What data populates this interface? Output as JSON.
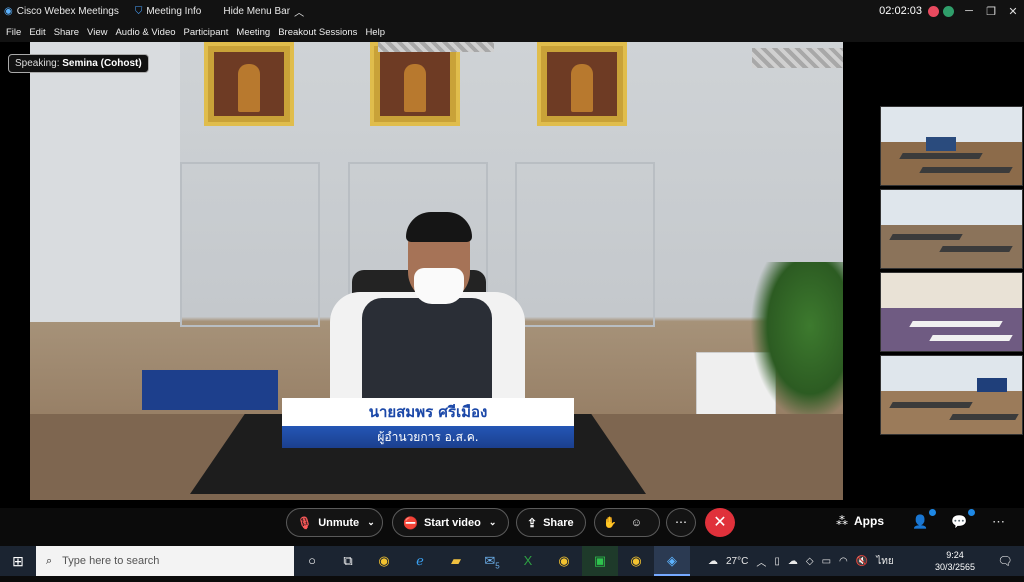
{
  "titlebar": {
    "app_name": "Cisco Webex Meetings",
    "meeting_info": "Meeting Info",
    "hide_menu_bar": "Hide Menu Bar",
    "time": "02:02:03"
  },
  "menu": {
    "items": [
      "File",
      "Edit",
      "Share",
      "View",
      "Audio & Video",
      "Participant",
      "Meeting",
      "Breakout Sessions",
      "Help"
    ]
  },
  "speaking": {
    "prefix": "Speaking:",
    "name": "Semina (Cohost)"
  },
  "caption": {
    "name": "นายสมพร  ศรีเมือง",
    "title": "ผู้อำนวยการ อ.ส.ค."
  },
  "controls": {
    "unmute": "Unmute",
    "start_video": "Start video",
    "share": "Share",
    "apps": "Apps"
  },
  "taskbar": {
    "search_placeholder": "Type here to search",
    "mail_badge": "5",
    "weather": "27°C",
    "language": "ไทย",
    "time": "9:24",
    "date": "30/3/2565"
  },
  "colors": {
    "leave_button": "#e0313b",
    "caption_blue": "#1b3f8e",
    "notification_badge": "#1e88e5"
  }
}
